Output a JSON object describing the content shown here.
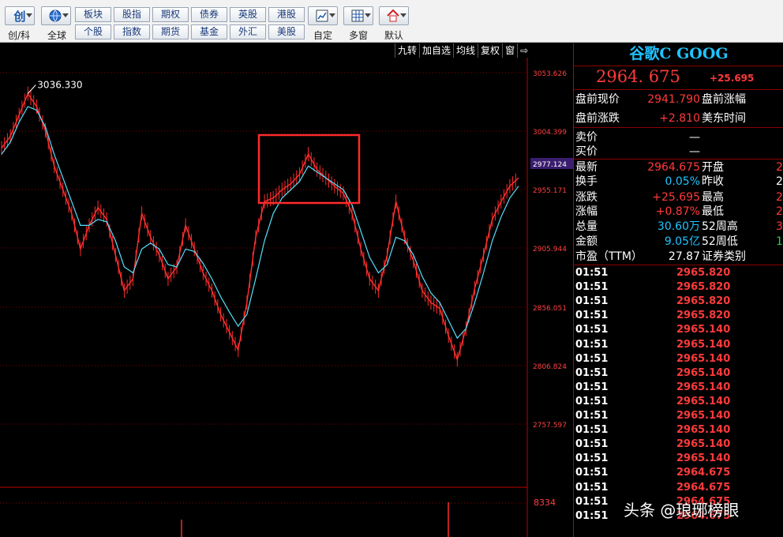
{
  "toolbar": {
    "groups": [
      {
        "label": "创/科",
        "icon": "创"
      },
      {
        "label": "全球",
        "icon": "globe-icon"
      },
      {
        "label": "自定",
        "icon": "chart-icon"
      },
      {
        "label": "多窗",
        "icon": "grid-icon"
      },
      {
        "label": "默认",
        "icon": "home-icon"
      }
    ],
    "buttons_row1": [
      "板块",
      "股指",
      "期权",
      "债券",
      "英股",
      "港股"
    ],
    "buttons_row2": [
      "个股",
      "指数",
      "期货",
      "基金",
      "外汇",
      "美股"
    ]
  },
  "chart_toolbar": [
    "九转",
    "加自选",
    "均线",
    "复权",
    "窗",
    "⇨"
  ],
  "chart": {
    "price_ticks": [
      "3053.626",
      "3004.399",
      "2955.171",
      "2905.944",
      "2856.051",
      "2806.824",
      "2757.597"
    ],
    "current_marker": "2977.124",
    "high_label": "3036.330",
    "volume_tick": "8334"
  },
  "chart_data": {
    "type": "line",
    "ylim": [
      2757.597,
      3053.626
    ],
    "y_ticks": [
      3053.626,
      3004.399,
      2955.171,
      2905.944,
      2856.051,
      2806.824,
      2757.597
    ],
    "series": [
      {
        "values": [
          2990,
          3000,
          3018,
          3036,
          3025,
          3005,
          2975,
          2955,
          2935,
          2905,
          2925,
          2940,
          2930,
          2900,
          2870,
          2880,
          2935,
          2915,
          2900,
          2880,
          2890,
          2925,
          2905,
          2885,
          2870,
          2850,
          2835,
          2820,
          2860,
          2915,
          2945,
          2948,
          2955,
          2960,
          2968,
          2985,
          2972,
          2965,
          2958,
          2952,
          2935,
          2905,
          2880,
          2870,
          2900,
          2945,
          2915,
          2895,
          2870,
          2860,
          2855,
          2832,
          2812,
          2838,
          2872,
          2900,
          2930,
          2945,
          2958,
          2965
        ]
      },
      {
        "values": [
          2985,
          2995,
          3012,
          3025,
          3022,
          3008,
          2985,
          2965,
          2945,
          2925,
          2925,
          2930,
          2928,
          2912,
          2890,
          2885,
          2905,
          2910,
          2905,
          2892,
          2890,
          2905,
          2903,
          2893,
          2880,
          2865,
          2852,
          2840,
          2850,
          2880,
          2912,
          2935,
          2948,
          2955,
          2962,
          2975,
          2970,
          2965,
          2960,
          2955,
          2942,
          2920,
          2898,
          2885,
          2892,
          2915,
          2912,
          2900,
          2882,
          2868,
          2860,
          2845,
          2830,
          2838,
          2860,
          2885,
          2912,
          2932,
          2948,
          2958
        ]
      }
    ]
  },
  "quote": {
    "title": "谷歌C GOOG",
    "price": "2964. 675",
    "change": "+25.695",
    "rows": [
      {
        "k": "盘前现价",
        "v": "2941.790",
        "k2": "盘前涨幅",
        "v2": "",
        "vc": "#ff3a3a"
      },
      {
        "k": "盘前涨跌",
        "v": "+2.810",
        "k2": "美东时间",
        "v2": "",
        "vc": "#ff3a3a"
      },
      {
        "k": "卖价",
        "v": "—",
        "k2": "",
        "v2": "",
        "vc": "#fff"
      },
      {
        "k": "买价",
        "v": "—",
        "k2": "",
        "v2": "",
        "vc": "#fff"
      },
      {
        "k": "最新",
        "v": "2964.675",
        "k2": "开盘",
        "v2": "2",
        "vc": "#ff3a3a",
        "v2c": "#ff3a3a"
      },
      {
        "k": "换手",
        "v": "0.05%",
        "k2": "昨收",
        "v2": "2",
        "vc": "#21c3ff",
        "v2c": "#fff"
      },
      {
        "k": "涨跌",
        "v": "+25.695",
        "k2": "最高",
        "v2": "2",
        "vc": "#ff3a3a",
        "v2c": "#ff3a3a"
      },
      {
        "k": "涨幅",
        "v": "+0.87%",
        "k2": "最低",
        "v2": "2",
        "vc": "#ff3a3a",
        "v2c": "#ff3a3a"
      },
      {
        "k": "总量",
        "v": "30.60万",
        "k2": "52周高",
        "v2": "3",
        "vc": "#21c3ff",
        "v2c": "#ff3a3a"
      },
      {
        "k": "金额",
        "v": "9.05亿",
        "k2": "52周低",
        "v2": "1",
        "vc": "#21c3ff",
        "v2c": "#2ecc40"
      },
      {
        "k": "市盈（TTM）",
        "v": "27.87",
        "k2": "证券类别",
        "v2": "",
        "vc": "#fff"
      }
    ],
    "ticks": [
      {
        "t": "01:51",
        "p": "2965.820"
      },
      {
        "t": "01:51",
        "p": "2965.820"
      },
      {
        "t": "01:51",
        "p": "2965.820"
      },
      {
        "t": "01:51",
        "p": "2965.820"
      },
      {
        "t": "01:51",
        "p": "2965.140"
      },
      {
        "t": "01:51",
        "p": "2965.140"
      },
      {
        "t": "01:51",
        "p": "2965.140"
      },
      {
        "t": "01:51",
        "p": "2965.140"
      },
      {
        "t": "01:51",
        "p": "2965.140"
      },
      {
        "t": "01:51",
        "p": "2965.140"
      },
      {
        "t": "01:51",
        "p": "2965.140"
      },
      {
        "t": "01:51",
        "p": "2965.140"
      },
      {
        "t": "01:51",
        "p": "2965.140"
      },
      {
        "t": "01:51",
        "p": "2965.140"
      },
      {
        "t": "01:51",
        "p": "2964.675"
      },
      {
        "t": "01:51",
        "p": "2964.675"
      },
      {
        "t": "01:51",
        "p": "2964.675"
      },
      {
        "t": "01:51",
        "p": "2964.675"
      }
    ]
  },
  "watermark": "头条 @琅琊榜眼"
}
